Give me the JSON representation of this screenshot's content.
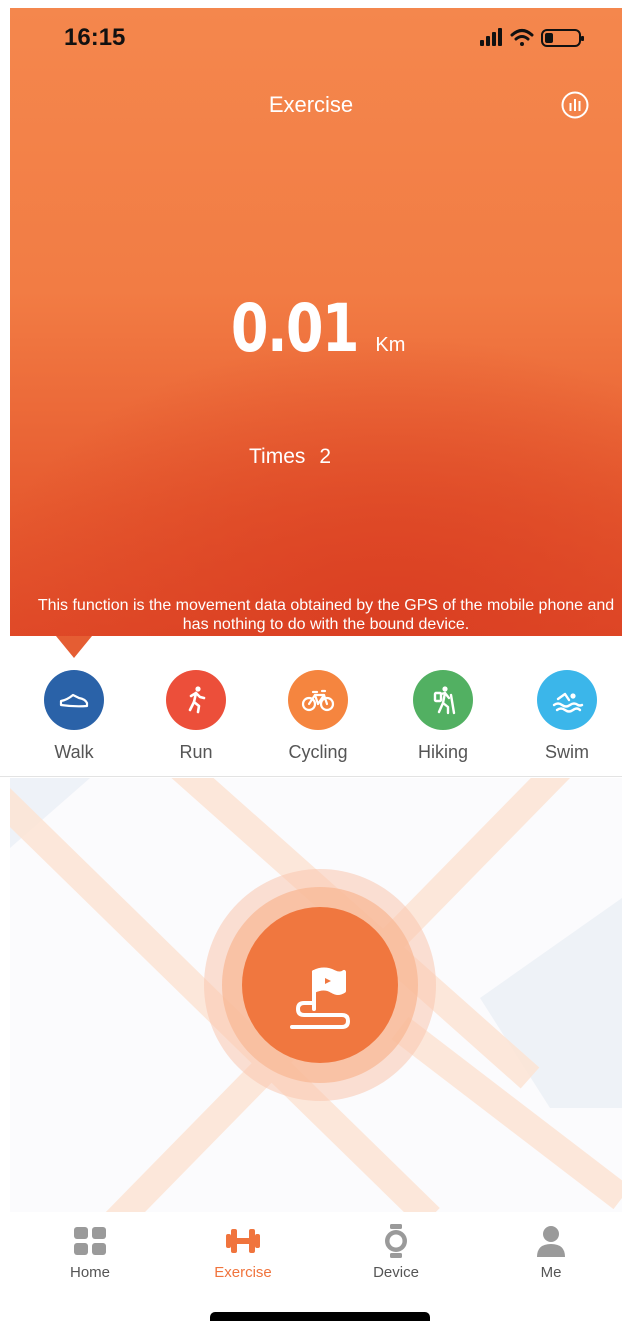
{
  "status_bar": {
    "time": "16:15"
  },
  "header": {
    "title": "Exercise"
  },
  "summary": {
    "distance": "0.01",
    "distance_unit": "Km",
    "times_label": "Times",
    "times_value": "2"
  },
  "notice": "This function is the movement data obtained by the GPS of the mobile phone and has nothing to do with the bound device.",
  "activity_types": [
    {
      "label": "Walk",
      "icon": "shoe-icon",
      "color": "#2a62a8",
      "selected": true
    },
    {
      "label": "Run",
      "icon": "runner-icon",
      "color": "#ec4f3a"
    },
    {
      "label": "Cycling",
      "icon": "bicycle-icon",
      "color": "#f5853f"
    },
    {
      "label": "Hiking",
      "icon": "hiker-icon",
      "color": "#52b062"
    },
    {
      "label": "Swim",
      "icon": "swimmer-icon",
      "color": "#3bb6ea"
    }
  ],
  "start_button": {
    "icon": "flag-route-icon",
    "color": "#f0773f"
  },
  "tabbar": [
    {
      "label": "Home",
      "icon": "grid-icon"
    },
    {
      "label": "Exercise",
      "icon": "dumbbell-icon",
      "active": true
    },
    {
      "label": "Device",
      "icon": "watch-icon"
    },
    {
      "label": "Me",
      "icon": "person-icon"
    }
  ],
  "colors": {
    "accent": "#f0743d",
    "walk_blue": "#2a62a8"
  }
}
